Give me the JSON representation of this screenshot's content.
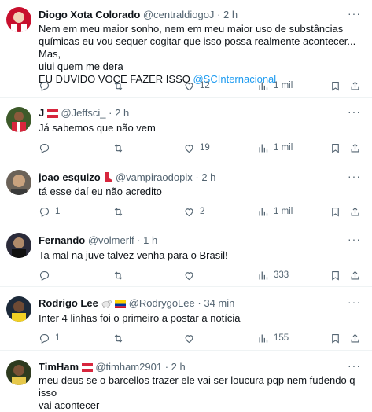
{
  "tweets": [
    {
      "name": "Diogo Xota Colorado",
      "handle": "@centraldiogoJ",
      "time": "2 h",
      "lines": [
        "Nem em meu maior sonho, nem em meu maior uso de substâncias",
        "químicas eu vou sequer cogitar que isso possa realmente acontecer... Mas,",
        "uiui quem me dera",
        "EU DUVIDO VOCE FAZER ISSO "
      ],
      "mention": "@SCInternacional",
      "replies": "",
      "retweets": "",
      "likes": "12",
      "views": "1 mil"
    },
    {
      "name": "J",
      "handle": "@Jeffsci_",
      "time": "2 h",
      "lines": [
        "Já sabemos que não vem"
      ],
      "replies": "",
      "retweets": "",
      "likes": "19",
      "views": "1 mil"
    },
    {
      "name": "joao esquizo",
      "handle": "@vampiraodopix",
      "time": "2 h",
      "lines": [
        "tá esse daí eu não acredito"
      ],
      "replies": "1",
      "retweets": "",
      "likes": "2",
      "views": "1 mil"
    },
    {
      "name": "Fernando",
      "handle": "@volmerlf",
      "time": "1 h",
      "lines": [
        "Ta mal na juve talvez venha para o Brasil!"
      ],
      "replies": "",
      "retweets": "",
      "likes": "",
      "views": "333"
    },
    {
      "name": "Rodrigo Lee",
      "handle": "@RodrygoLee",
      "time": "34 min",
      "lines": [
        "Inter 4 linhas foi o primeiro a postar a notícia"
      ],
      "replies": "1",
      "retweets": "",
      "likes": "",
      "views": "155"
    },
    {
      "name": "TimHam",
      "handle": "@timham2901",
      "time": "2 h",
      "lines": [
        "meu deus se o barcellos trazer ele vai ser loucura pqp nem fudendo q isso",
        "vai acontecer"
      ]
    }
  ],
  "separator": "·",
  "more_glyph": "···",
  "colors": {
    "text": "#0f1419",
    "secondary": "#536471",
    "link": "#1d9bf0",
    "divider": "#eff3f4",
    "red": "#d7263d"
  },
  "icons": [
    "reply-icon",
    "retweet-icon",
    "like-icon",
    "views-icon",
    "bookmark-icon",
    "share-icon",
    "more-icon",
    "flag-icon",
    "goat-icon",
    "red-boot-icon"
  ]
}
